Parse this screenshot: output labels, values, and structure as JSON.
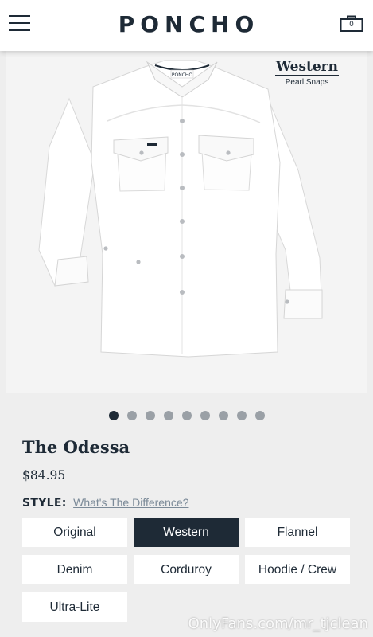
{
  "header": {
    "brand": "PONCHO",
    "cart_count": "0"
  },
  "hero": {
    "tag_title": "Western",
    "tag_subtitle": "Pearl Snaps",
    "shirt_label": "PONCHO"
  },
  "carousel": {
    "count": 9,
    "active_index": 0
  },
  "product": {
    "title": "The Odessa",
    "price": "$84.95"
  },
  "style": {
    "label": "STYLE:",
    "link": "What's The Difference?",
    "options": [
      "Original",
      "Western",
      "Flannel",
      "Denim",
      "Corduroy",
      "Hoodie / Crew",
      "Ultra-Lite"
    ],
    "selected": "Western"
  },
  "watermark": "OnlyFans.com/mr_tjclean",
  "colors": {
    "navy": "#1e2a36",
    "background": "#eeeeee",
    "link": "#7b8a98"
  }
}
